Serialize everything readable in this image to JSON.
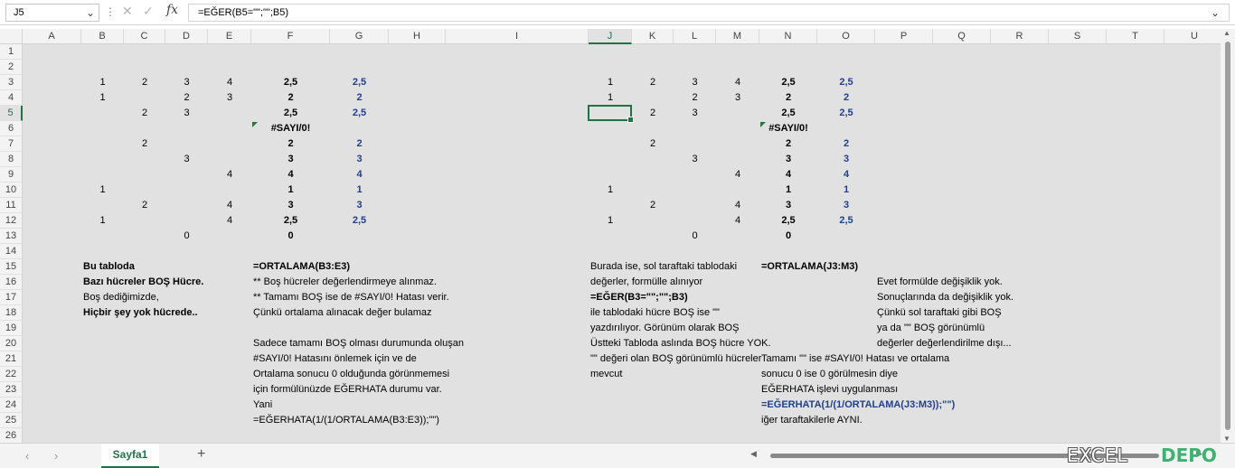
{
  "name_box": {
    "value": "J5"
  },
  "formula_bar": {
    "formula": "=EĞER(B5=\"\";\"\";B5)"
  },
  "columns": [
    "A",
    "B",
    "C",
    "D",
    "E",
    "F",
    "G",
    "H",
    "I",
    "J",
    "K",
    "L",
    "M",
    "N",
    "O",
    "P",
    "Q",
    "R",
    "S",
    "T",
    "U"
  ],
  "rows": [
    "1",
    "2",
    "3",
    "4",
    "5",
    "6",
    "7",
    "8",
    "9",
    "10",
    "11",
    "12",
    "13",
    "14",
    "15",
    "16",
    "17",
    "18",
    "19",
    "20",
    "21",
    "22",
    "23",
    "24",
    "25",
    "26"
  ],
  "selected": {
    "column": "J",
    "row": "5"
  },
  "cells": {
    "B3": "1",
    "C3": "2",
    "D3": "3",
    "E3": "4",
    "F3": "2,5",
    "G3": "2,5",
    "B4": "1",
    "D4": "2",
    "E4": "3",
    "F4": "2",
    "G4": "2",
    "C5": "2",
    "D5": "3",
    "F5": "2,5",
    "G5": "2,5",
    "F6": "#SAYI/0!",
    "C7": "2",
    "F7": "2",
    "G7": "2",
    "D8": "3",
    "F8": "3",
    "G8": "3",
    "E9": "4",
    "F9": "4",
    "G9": "4",
    "B10": "1",
    "F10": "1",
    "G10": "1",
    "C11": "2",
    "E11": "4",
    "F11": "3",
    "G11": "3",
    "B12": "1",
    "E12": "4",
    "F12": "2,5",
    "G12": "2,5",
    "D13": "0",
    "F13": "0",
    "J3": "1",
    "K3": "2",
    "L3": "3",
    "M3": "4",
    "N3": "2,5",
    "O3": "2,5",
    "J4": "1",
    "L4": "2",
    "M4": "3",
    "N4": "2",
    "O4": "2",
    "K5": "2",
    "L5": "3",
    "N5": "2,5",
    "O5": "2,5",
    "N6": "#SAYI/0!",
    "K7": "2",
    "N7": "2",
    "O7": "2",
    "L8": "3",
    "N8": "3",
    "O8": "3",
    "M9": "4",
    "N9": "4",
    "O9": "4",
    "J10": "1",
    "N10": "1",
    "O10": "1",
    "K11": "2",
    "M11": "4",
    "N11": "3",
    "O11": "3",
    "J12": "1",
    "M12": "4",
    "N12": "2,5",
    "O12": "2,5",
    "L13": "0",
    "N13": "0",
    "B15": "Bu tabloda",
    "B16": "Bazı hücreler BOŞ Hücre.",
    "B17": "Boş dediğimizde,",
    "B18": "Hiçbir şey yok hücrede..",
    "F15": "=ORTALAMA(B3:E3)",
    "F16": "** Boş hücreler değerlendirmeye alınmaz.",
    "F17": "** Tamamı BOŞ ise de #SAYI/0! Hatası verir.",
    "F18": "Çünkü ortalama alınacak değer bulamaz",
    "F20": "Sadece tamamı BOŞ olması durumunda oluşan",
    "F21": "#SAYI/0! Hatasını önlemek için ve de",
    "F22": "Ortalama sonucu 0 olduğunda görünmemesi",
    "F23": "için formülünüzde EĞERHATA durumu var.",
    "F24": "Yani",
    "F25": "=EĞERHATA(1/(1/ORTALAMA(B3:E3));\"\")",
    "J15": "Burada ise, sol taraftaki tablodaki",
    "J16": "değerler, formülle alınıyor",
    "J17": "=EĞER(B3=\"\";\"\";B3)",
    "J18": "ile tablodaki hücre BOŞ ise \"\"",
    "J19": "yazdırılıyor. Görünüm olarak BOŞ",
    "J20": "Üstteki Tabloda aslında BOŞ hücre YOK.",
    "J21": "\"\" değeri olan BOŞ görünümlü hücreler",
    "J22": "mevcut",
    "N15": "=ORTALAMA(J3:M3)",
    "P16": "Evet formülde değişiklik yok.",
    "P17": "Sonuçlarında da değişiklik yok.",
    "P18": "Çünkü sol taraftaki gibi BOŞ",
    "P19": "ya da \"\" BOŞ görünümlü",
    "P20": "değerler değerlendirilme dışı...",
    "N21": "Tamamı \"\" ise #SAYI/0! Hatası ve ortalama",
    "N22": "sonucu 0 ise 0 görülmesin diye",
    "N23": "EĞERHATA işlevi uygulanması",
    "N24": "=EĞERHATA(1/(1/ORTALAMA(J3:M3));\"\")",
    "N25": "iğer taraftakilerle AYNI."
  },
  "sheet_tab": {
    "label": "Sayfa1"
  },
  "watermark": {
    "left": "EXCEL",
    "right": "DEPO"
  },
  "icons": {
    "cancel": "cancel-icon",
    "enter": "enter-icon",
    "function": "fx-icon"
  },
  "colors": {
    "accent": "#217346",
    "value_blue": "#1f3f8f",
    "error_triangle": "#1e7b34",
    "depo_green": "#3cb371"
  }
}
